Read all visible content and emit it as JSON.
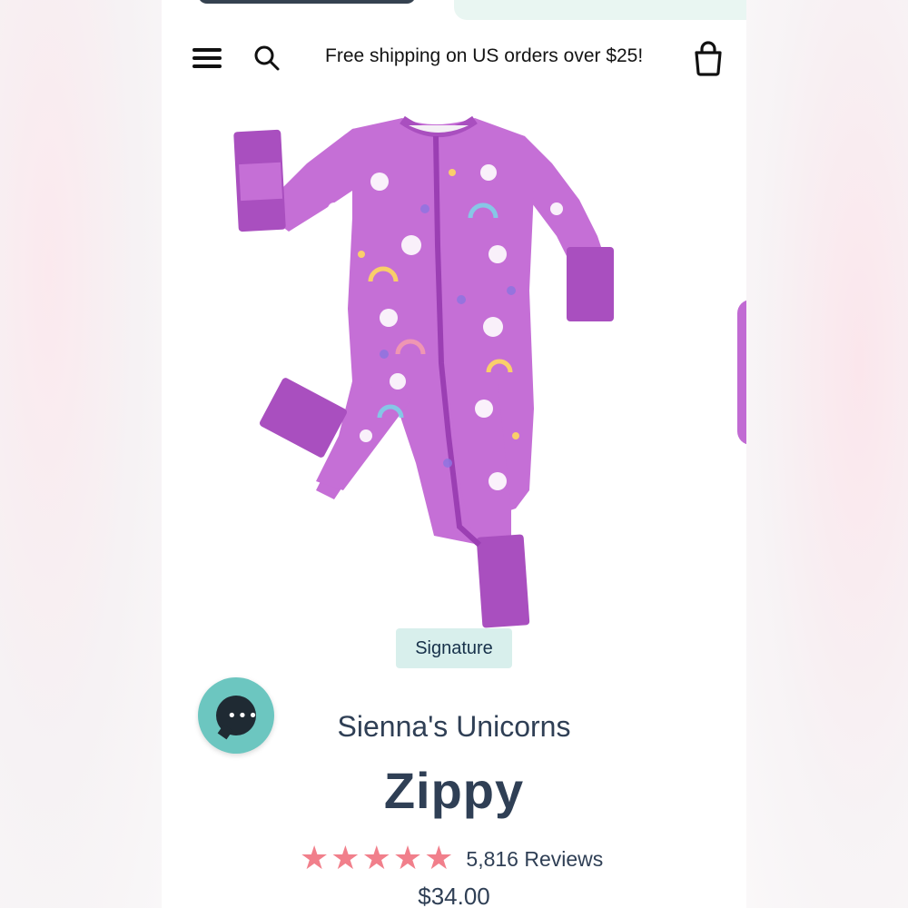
{
  "header": {
    "promo_text": "Free shipping on US orders over $25!"
  },
  "icons": {
    "menu": "hamburger-menu-icon",
    "search": "search-icon",
    "cart": "shopping-bag-icon",
    "chat": "chat-bubble-icon"
  },
  "product": {
    "badge": "Signature",
    "collection": "Sienna's Unicorns",
    "name": "Zippy",
    "rating_value": 5,
    "reviews_label": "5,816 Reviews",
    "price": "$34.00",
    "image_alt_colors": {
      "fabric": "#c56fd6",
      "cuff": "#a94fbf"
    }
  },
  "colors": {
    "accent_teal": "#6cc6c0",
    "badge_bg": "#d8efec",
    "star": "#f17f8b",
    "text_navy": "#2f3f55"
  }
}
